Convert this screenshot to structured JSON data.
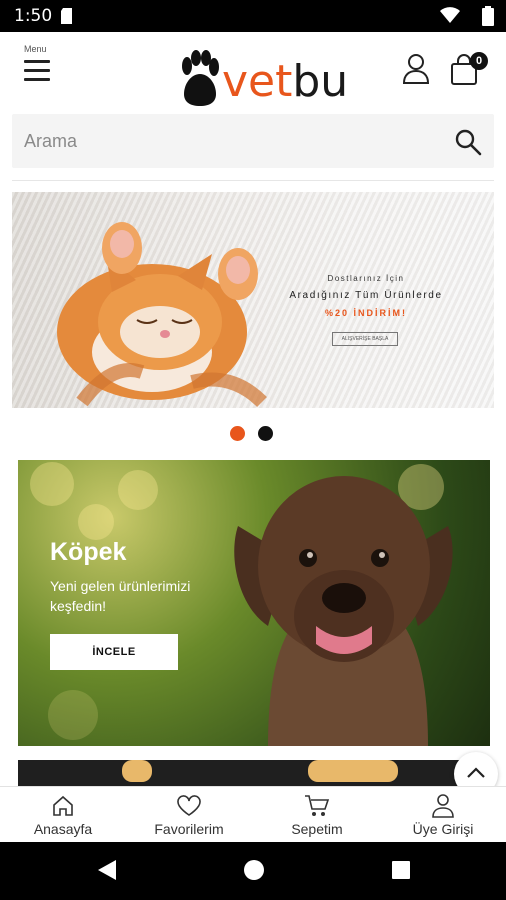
{
  "status_bar": {
    "time": "1:50"
  },
  "header": {
    "menu_label": "Menu",
    "logo_part1": "vet",
    "logo_part2": "bu",
    "cart_count": "0"
  },
  "search": {
    "placeholder": "Arama"
  },
  "hero_slider": {
    "line1": "Dostlarınız İçin",
    "line2": "Aradığınız Tüm Ürünlerde",
    "line3": "%20 İNDİRİM!",
    "button": "ALIŞVERİŞE BAŞLA",
    "active_slide": 1,
    "slide_count": 2
  },
  "promo": {
    "title": "Köpek",
    "subtitle": "Yeni gelen ürünlerimizi keşfedin!",
    "button": "İNCELE"
  },
  "tabbar": {
    "items": [
      {
        "label": "Anasayfa",
        "icon": "home-icon"
      },
      {
        "label": "Favorilerim",
        "icon": "heart-icon"
      },
      {
        "label": "Sepetim",
        "icon": "cart-icon"
      },
      {
        "label": "Üye Girişi",
        "icon": "user-icon"
      }
    ]
  },
  "colors": {
    "accent": "#e8561c",
    "dark": "#1a1a1a"
  }
}
